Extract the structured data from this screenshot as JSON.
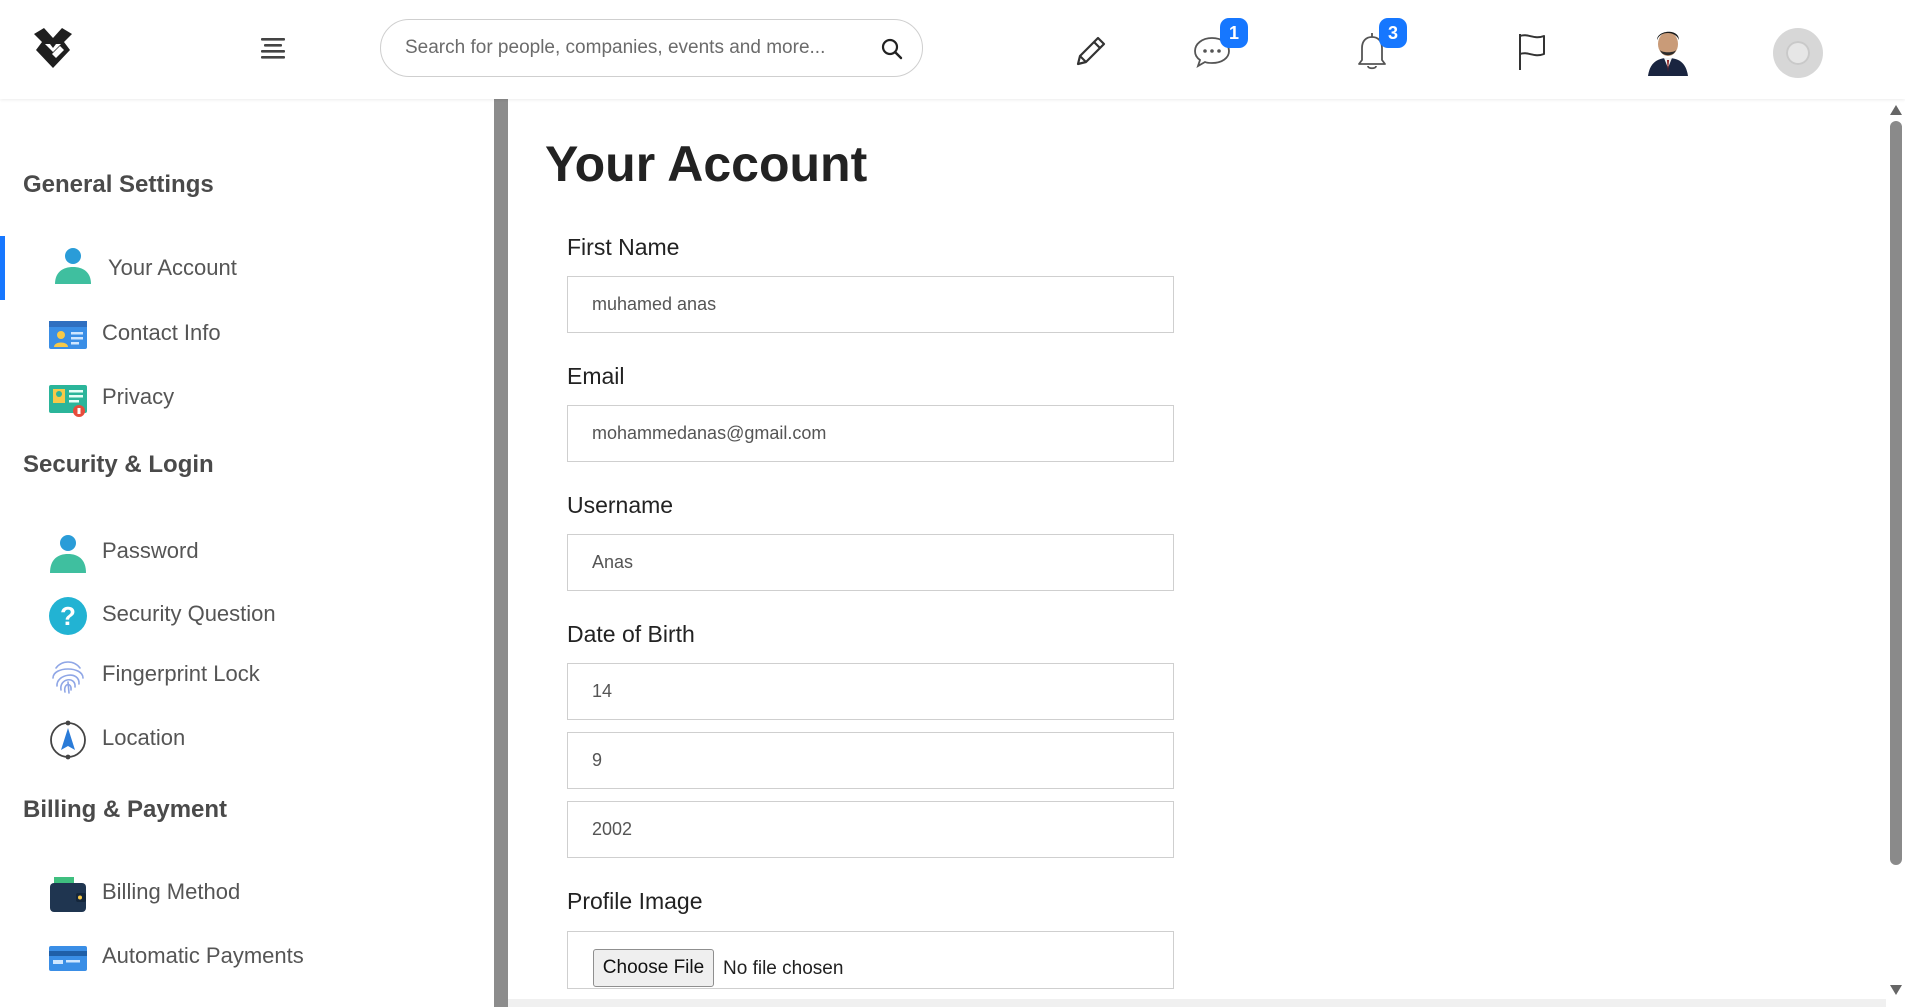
{
  "header": {
    "search_placeholder": "Search for people, companies, events and more...",
    "messages_badge": "1",
    "notifications_badge": "3"
  },
  "sidebar": {
    "sections": [
      {
        "title": "General Settings",
        "items": [
          {
            "label": "Your Account",
            "active": true
          },
          {
            "label": "Contact Info"
          },
          {
            "label": "Privacy"
          }
        ]
      },
      {
        "title": "Security & Login",
        "items": [
          {
            "label": "Password"
          },
          {
            "label": "Security Question"
          },
          {
            "label": "Fingerprint Lock"
          },
          {
            "label": "Location"
          }
        ]
      },
      {
        "title": "Billing & Payment",
        "items": [
          {
            "label": "Billing Method"
          },
          {
            "label": "Automatic Payments"
          }
        ]
      }
    ]
  },
  "main": {
    "title": "Your Account",
    "fields": {
      "first_name": {
        "label": "First Name",
        "value": "muhamed anas"
      },
      "email": {
        "label": "Email",
        "value": "mohammedanas@gmail.com"
      },
      "username": {
        "label": "Username",
        "value": "Anas"
      },
      "dob": {
        "label": "Date of Birth",
        "day": "14",
        "month": "9",
        "year": "2002"
      },
      "profile_image": {
        "label": "Profile Image",
        "button": "Choose File",
        "status": "No file chosen"
      }
    }
  },
  "colors": {
    "accent": "#1677ff",
    "divider": "#8c8c8c"
  }
}
